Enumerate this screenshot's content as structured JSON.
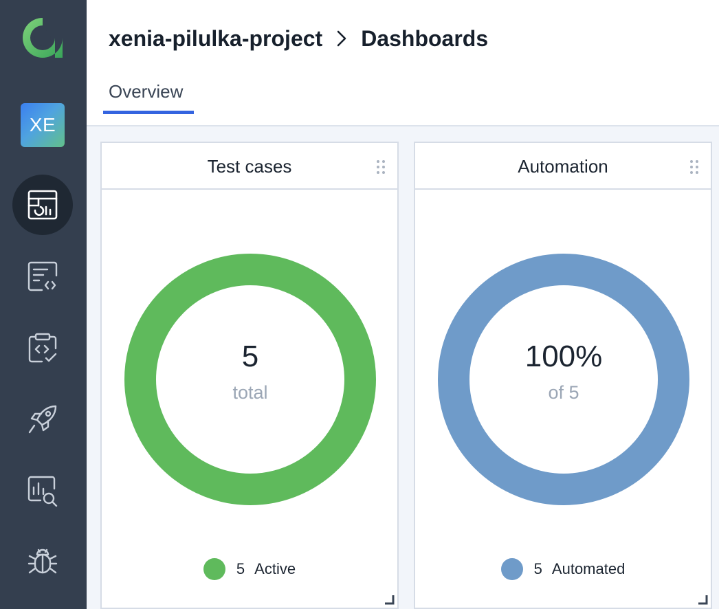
{
  "sidebar": {
    "logo_icon": "allure-logo-icon",
    "project_badge": "XE",
    "items": [
      {
        "icon": "dashboards-icon",
        "active": true
      },
      {
        "icon": "test-cases-icon",
        "active": false
      },
      {
        "icon": "test-plans-icon",
        "active": false
      },
      {
        "icon": "launches-icon",
        "active": false
      },
      {
        "icon": "analytics-icon",
        "active": false
      },
      {
        "icon": "defects-icon",
        "active": false
      }
    ]
  },
  "header": {
    "project_name": "xenia-pilulka-project",
    "separator_icon": "chevron-right-icon",
    "page_title": "Dashboards",
    "tabs": [
      {
        "label": "Overview",
        "active": true
      }
    ]
  },
  "widgets": [
    {
      "title": "Test cases",
      "value": "5",
      "sub": "total",
      "color": "#5fba5c",
      "legend": {
        "count": "5",
        "label": "Active"
      }
    },
    {
      "title": "Automation",
      "value": "100%",
      "sub": "of 5",
      "color": "#6f9bc9",
      "legend": {
        "count": "5",
        "label": "Automated"
      }
    }
  ],
  "colors": {
    "sidebar_bg": "#343f4f",
    "active_nav_bg": "#1f2833",
    "accent": "#3464e0",
    "active_green": "#5fba5c",
    "automated_blue": "#6f9bc9"
  }
}
